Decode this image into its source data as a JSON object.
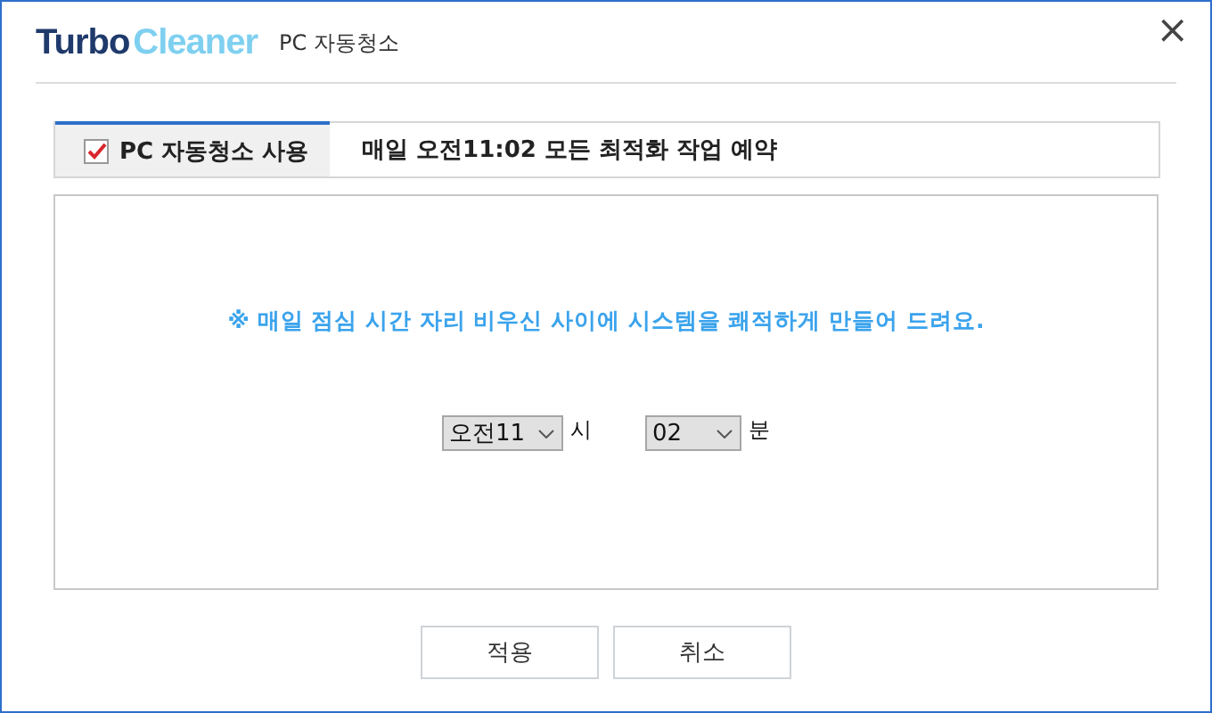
{
  "window": {
    "logo_part_1": "Turbo",
    "logo_part_2": "Cleaner",
    "title": "PC 자동청소",
    "close": "×"
  },
  "auto_clean": {
    "label": "PC 자동청소 사용",
    "checked": true
  },
  "schedule_summary": "매일 오전11:02 모든 최적화 작업 예약",
  "notice": "※ 매일 점심 시간 자리 비우신 사이에 시스템을 쾌적하게 만들어 드려요.",
  "time_selects": [
    {
      "value": "오전11",
      "unit": "시"
    },
    {
      "value": "02",
      "unit": "분"
    }
  ],
  "buttons": [
    "적용",
    "취소"
  ]
}
